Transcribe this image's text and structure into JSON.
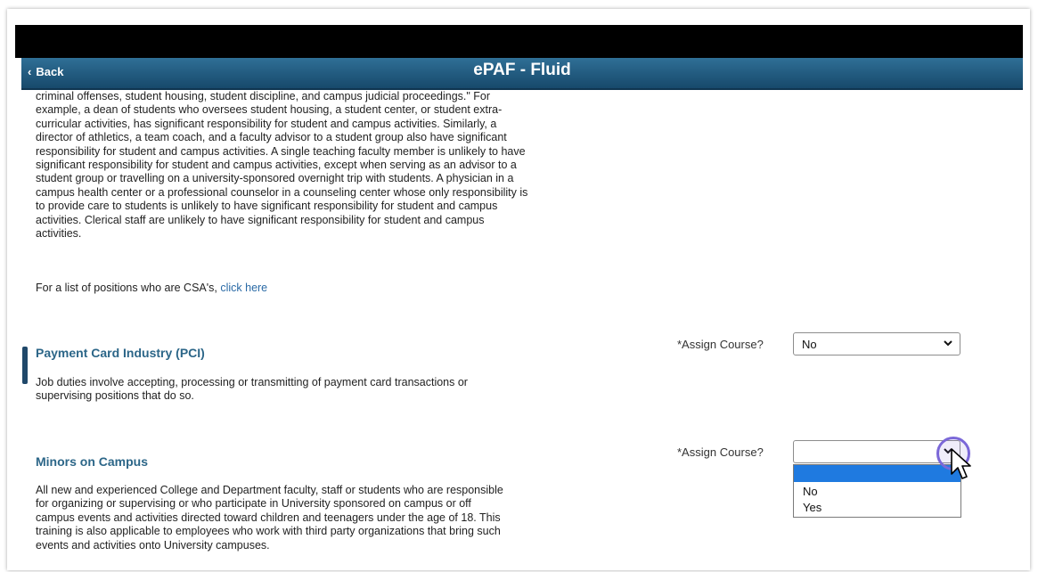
{
  "header": {
    "back_label": "Back",
    "title": "ePAF - Fluid"
  },
  "csa": {
    "paragraph_lines": [
      "criminal offenses, student housing, student discipline, and campus judicial proceedings.\"  For",
      "example, a dean of students who oversees student housing, a student center, or student extra-",
      "curricular activities, has significant responsibility for student and campus activities.  Similarly, a",
      "director of athletics, a team coach, and a faculty advisor to a student group also have significant",
      "responsibility for student and campus activities.  A single teaching faculty member is unlikely to have",
      "significant responsibility for student and campus activities, except when serving as an advisor to a",
      "student group or travelling on a university-sponsored overnight trip with students.  A physician in a",
      "campus health center or a professional counselor in a counseling center whose only responsibility is",
      "to provide care to students is unlikely to have significant responsibility for student and campus",
      "activities.  Clerical staff are unlikely to have significant responsibility for student and campus",
      "activities."
    ],
    "list_text": "For a list of positions who are CSA's,",
    "list_link": "click here"
  },
  "pci": {
    "heading": "Payment Card Industry (PCI)",
    "description_lines": [
      "Job duties involve accepting, processing or transmitting of payment card transactions or",
      "supervising positions that do so."
    ],
    "assign_label": "*Assign Course?",
    "assign_value": "No"
  },
  "minors": {
    "heading": "Minors on Campus",
    "description_lines": [
      "All new and experienced College and Department faculty, staff  or students who are responsible",
      "for organizing or supervising or who participate in University sponsored on campus or off",
      "campus events and activities directed toward children and teenagers under the age of 18. This",
      "training is also applicable to employees who work with third party organizations that bring such",
      "events and activities onto University campuses."
    ],
    "assign_label": "*Assign Course?",
    "assign_value": "",
    "options": [
      "No",
      "Yes"
    ]
  },
  "colors": {
    "header_top": "#2f6f96",
    "header_bottom": "#17496b",
    "heading": "#2c6688",
    "link": "#2a6aa6",
    "dropdown_highlight": "#1f7ae0",
    "cursor_ring": "#7b68d8"
  },
  "icons": {
    "back": "chevron-left-icon",
    "select_arrow": "chevron-down-icon",
    "pointer": "mouse-pointer-icon"
  }
}
